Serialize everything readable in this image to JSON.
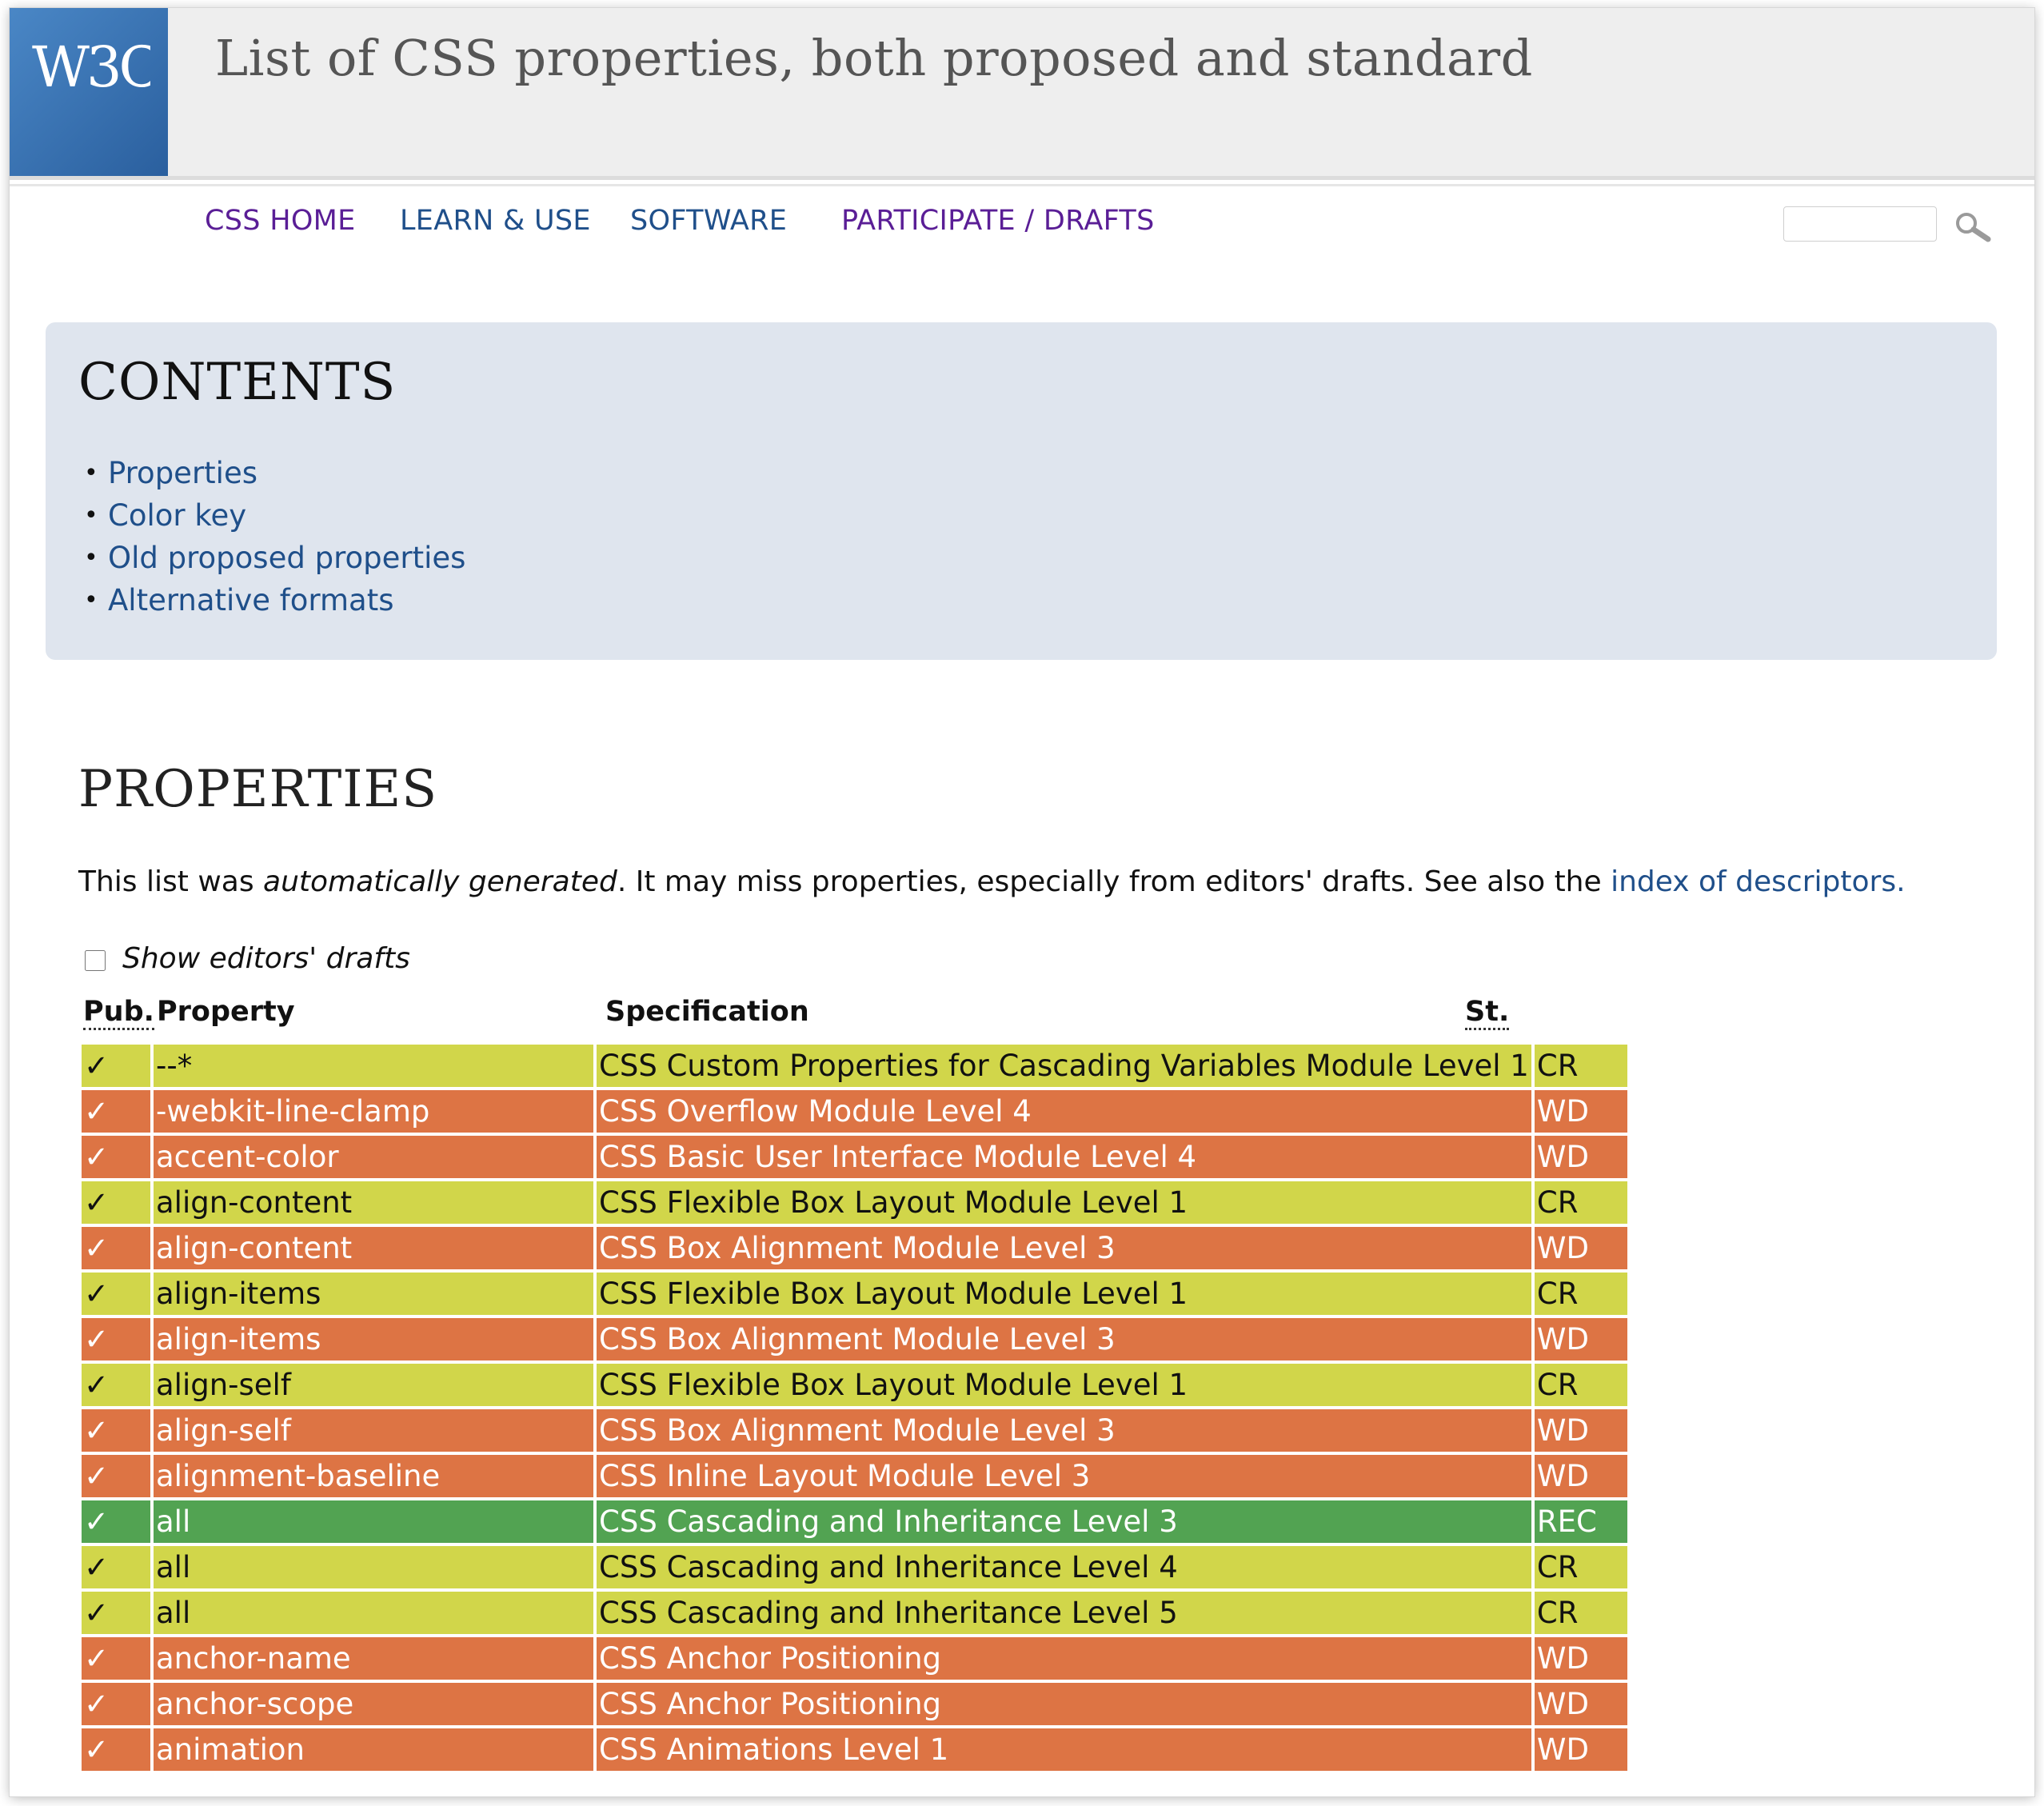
{
  "header": {
    "logo_text": "W3C",
    "title": "List of CSS properties, both proposed and standard"
  },
  "nav": {
    "items": [
      {
        "label": "CSS HOME"
      },
      {
        "label": "LEARN & USE"
      },
      {
        "label": "SOFTWARE"
      },
      {
        "label": "PARTICIPATE / DRAFTS"
      }
    ],
    "search": {
      "value": ""
    }
  },
  "contents": {
    "title": "CONTENTS",
    "items": [
      {
        "label": "Properties"
      },
      {
        "label": "Color key"
      },
      {
        "label": "Old proposed properties"
      },
      {
        "label": "Alternative formats"
      }
    ]
  },
  "properties": {
    "title": "PROPERTIES",
    "intro": {
      "part1": "This list was ",
      "emphasis": "automatically generated",
      "part2": ". It may miss properties, especially from editors' drafts. See also the ",
      "link": "index of descriptors."
    },
    "show_drafts_label": "Show editors' drafts",
    "show_drafts_checked": false,
    "columns": {
      "pub": "Pub.",
      "property": "Property",
      "specification": "Specification",
      "status": "St."
    },
    "status_colors": {
      "CR": "#d1d64a",
      "WD": "#dd7444",
      "REC": "#52a352"
    },
    "rows": [
      {
        "pub": "✓",
        "property": "--*",
        "specification": "CSS Custom Properties for Cascading Variables Module Level 1",
        "status": "CR"
      },
      {
        "pub": "✓",
        "property": "-webkit-line-clamp",
        "specification": "CSS Overflow Module Level 4",
        "status": "WD"
      },
      {
        "pub": "✓",
        "property": "accent-color",
        "specification": "CSS Basic User Interface Module Level 4",
        "status": "WD"
      },
      {
        "pub": "✓",
        "property": "align-content",
        "specification": "CSS Flexible Box Layout Module Level 1",
        "status": "CR"
      },
      {
        "pub": "✓",
        "property": "align-content",
        "specification": "CSS Box Alignment Module Level 3",
        "status": "WD"
      },
      {
        "pub": "✓",
        "property": "align-items",
        "specification": "CSS Flexible Box Layout Module Level 1",
        "status": "CR"
      },
      {
        "pub": "✓",
        "property": "align-items",
        "specification": "CSS Box Alignment Module Level 3",
        "status": "WD"
      },
      {
        "pub": "✓",
        "property": "align-self",
        "specification": "CSS Flexible Box Layout Module Level 1",
        "status": "CR"
      },
      {
        "pub": "✓",
        "property": "align-self",
        "specification": "CSS Box Alignment Module Level 3",
        "status": "WD"
      },
      {
        "pub": "✓",
        "property": "alignment-baseline",
        "specification": "CSS Inline Layout Module Level 3",
        "status": "WD"
      },
      {
        "pub": "✓",
        "property": "all",
        "specification": "CSS Cascading and Inheritance Level 3",
        "status": "REC"
      },
      {
        "pub": "✓",
        "property": "all",
        "specification": "CSS Cascading and Inheritance Level 4",
        "status": "CR"
      },
      {
        "pub": "✓",
        "property": "all",
        "specification": "CSS Cascading and Inheritance Level 5",
        "status": "CR"
      },
      {
        "pub": "✓",
        "property": "anchor-name",
        "specification": "CSS Anchor Positioning",
        "status": "WD"
      },
      {
        "pub": "✓",
        "property": "anchor-scope",
        "specification": "CSS Anchor Positioning",
        "status": "WD"
      },
      {
        "pub": "✓",
        "property": "animation",
        "specification": "CSS Animations Level 1",
        "status": "WD"
      }
    ]
  }
}
